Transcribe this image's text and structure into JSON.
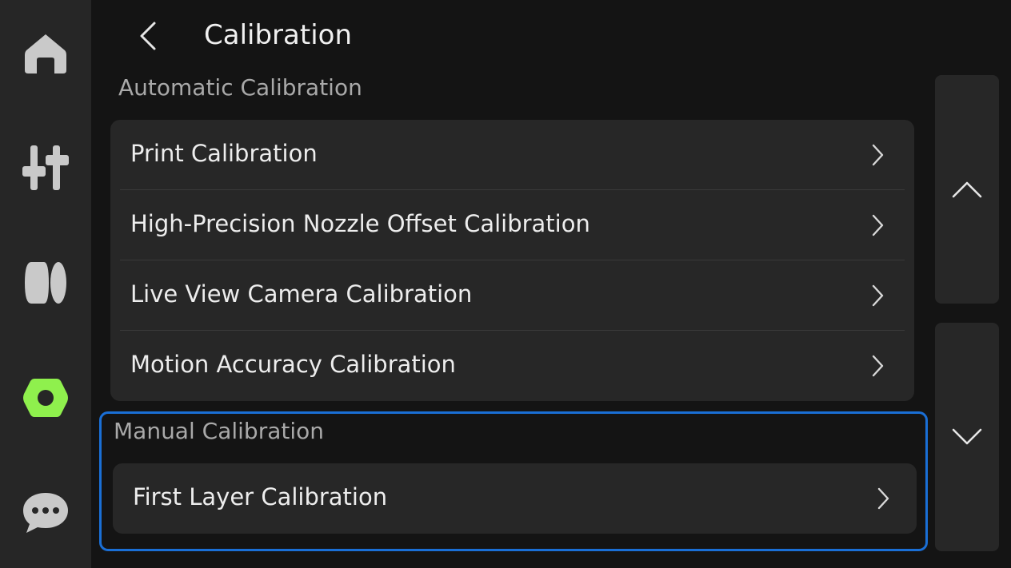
{
  "header": {
    "title": "Calibration",
    "back_icon": "chevron-left-icon"
  },
  "sidebar": {
    "items": [
      {
        "icon": "home-icon",
        "active": false
      },
      {
        "icon": "sliders-icon",
        "active": false
      },
      {
        "icon": "filament-spool-icon",
        "active": false
      },
      {
        "icon": "hex-nut-settings-icon",
        "active": true
      },
      {
        "icon": "chat-bubble-icon",
        "active": false
      }
    ]
  },
  "automatic": {
    "label": "Automatic Calibration",
    "items": [
      {
        "label": "Print Calibration"
      },
      {
        "label": "High-Precision Nozzle Offset Calibration"
      },
      {
        "label": "Live View Camera Calibration"
      },
      {
        "label": "Motion Accuracy Calibration"
      }
    ]
  },
  "manual": {
    "label": "Manual Calibration",
    "items": [
      {
        "label": "First Layer Calibration"
      }
    ]
  },
  "scroll": {
    "up_icon": "chevron-up-icon",
    "down_icon": "chevron-down-icon"
  },
  "colors": {
    "active_icon": "#8ff04d",
    "inactive_icon": "#c9c9c9",
    "focus_border": "#1a6fd6",
    "card_bg": "#272727",
    "page_bg": "#141414"
  }
}
